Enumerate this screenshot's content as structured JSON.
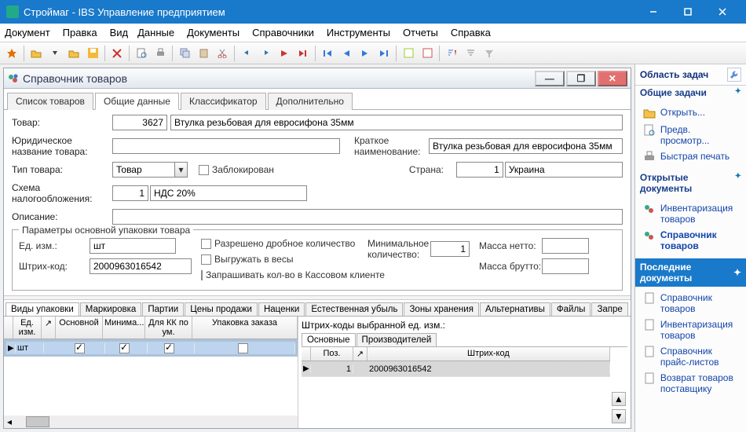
{
  "window": {
    "title": "Строймаг - IBS Управление предприятием"
  },
  "menubar": [
    "Документ",
    "Правка",
    "Вид",
    "Данные",
    "Документы",
    "Справочники",
    "Инструменты",
    "Отчеты",
    "Справка"
  ],
  "mdi": {
    "title": "Справочник товаров"
  },
  "tabs": [
    "Список товаров",
    "Общие данные",
    "Классификатор",
    "Дополнительно"
  ],
  "active_tab": 1,
  "form": {
    "tovar_label": "Товар:",
    "tovar_code": "3627",
    "tovar_name": "Втулка резьбовая для евросифона 35мм",
    "legal_name_label": "Юридическое название товара:",
    "legal_name": "",
    "short_name_label": "Краткое наименование:",
    "short_name": "Втулка резьбовая для евросифона 35мм",
    "type_label": "Тип товара:",
    "type_value": "Товар",
    "blocked_label": "Заблокирован",
    "country_label": "Страна:",
    "country_code": "1",
    "country_name": "Украина",
    "tax_label": "Схема налогообложения:",
    "tax_code": "1",
    "tax_name": "НДС 20%",
    "desc_label": "Описание:",
    "desc": ""
  },
  "package": {
    "legend": "Параметры основной упаковки товара",
    "unit_label": "Ед. изм.:",
    "unit_value": "шт",
    "barcode_label": "Штрих-код:",
    "barcode_value": "2000963016542",
    "allow_frac": "Разрешено дробное количество",
    "to_scales": "Выгружать в весы",
    "ask_qty": "Запрашивать кол-во в Кассовом клиенте",
    "min_qty_label": "Минимальное количество:",
    "min_qty": "1",
    "net_label": "Масса нетто:",
    "gross_label": "Масса брутто:"
  },
  "subtabs": [
    "Виды упаковки",
    "Маркировка",
    "Партии",
    "Цены продажи",
    "Наценки",
    "Естественная убыль",
    "Зоны хранения",
    "Альтернативы",
    "Файлы",
    "Запре"
  ],
  "grid_left": {
    "cols": [
      "Ед. изм.",
      "↗",
      "Основной",
      "Минима...",
      "Для КК по ум.",
      "Упаковка заказа"
    ],
    "row": {
      "unit": "шт",
      "main": true,
      "min": true,
      "kk": true,
      "order": false
    }
  },
  "grid_right": {
    "title": "Штрих-коды выбранной ед. изм.:",
    "tabs": [
      "Основные",
      "Производителей"
    ],
    "cols": [
      "Поз.",
      "↗",
      "Штрих-код"
    ],
    "row": {
      "pos": "1",
      "code": "2000963016542"
    }
  },
  "task_pane": {
    "header": "Область задач",
    "sections": {
      "common": {
        "title": "Общие задачи",
        "items": [
          "Открыть...",
          "Предв. просмотр...",
          "Быстрая печать"
        ]
      },
      "open_docs": {
        "title": "Открытые документы",
        "items": [
          "Инвентаризация товаров",
          "Справочник товаров"
        ],
        "active": 1
      },
      "recent": {
        "title": "Последние документы",
        "items": [
          "Справочник товаров",
          "Инвентаризация товаров",
          "Справочник прайс-листов",
          "Возврат товаров поставщику"
        ]
      }
    }
  }
}
